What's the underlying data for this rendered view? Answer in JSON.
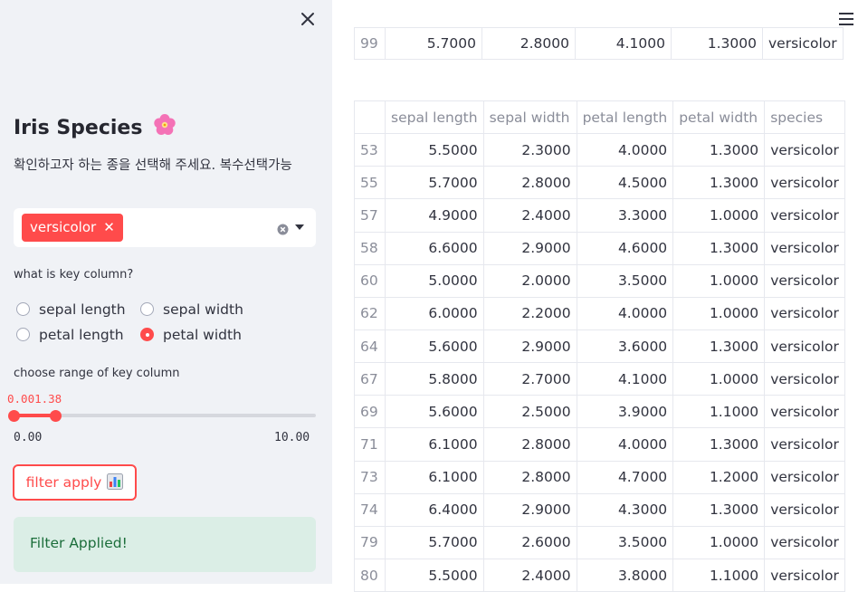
{
  "sidebar": {
    "title": "Iris Species",
    "description": "확인하고자 하는 종을 선택해 주세요. 복수선택가능",
    "multiselect": {
      "selected": [
        "versicolor"
      ]
    },
    "key_column": {
      "label": "what is key column?",
      "options": [
        "sepal length",
        "sepal width",
        "petal length",
        "petal width"
      ],
      "selected": "petal width"
    },
    "range": {
      "label": "choose range of key column",
      "value_text": "0.001.38",
      "low": 0.0,
      "high": 1.38,
      "min_label": "0.00",
      "max_label": "10.00",
      "min": 0,
      "max": 10
    },
    "filter_button": "filter apply",
    "alert": "Filter Applied!"
  },
  "top_table": {
    "row": {
      "index": "99",
      "sepal_length": "5.7000",
      "sepal_width": "2.8000",
      "petal_length": "4.1000",
      "petal_width": "1.3000",
      "species": "versicolor"
    }
  },
  "main_table": {
    "headers": [
      "",
      "sepal length",
      "sepal width",
      "petal length",
      "petal width",
      "species"
    ],
    "rows": [
      [
        "53",
        "5.5000",
        "2.3000",
        "4.0000",
        "1.3000",
        "versicolor"
      ],
      [
        "55",
        "5.7000",
        "2.8000",
        "4.5000",
        "1.3000",
        "versicolor"
      ],
      [
        "57",
        "4.9000",
        "2.4000",
        "3.3000",
        "1.0000",
        "versicolor"
      ],
      [
        "58",
        "6.6000",
        "2.9000",
        "4.6000",
        "1.3000",
        "versicolor"
      ],
      [
        "60",
        "5.0000",
        "2.0000",
        "3.5000",
        "1.0000",
        "versicolor"
      ],
      [
        "62",
        "6.0000",
        "2.2000",
        "4.0000",
        "1.0000",
        "versicolor"
      ],
      [
        "64",
        "5.6000",
        "2.9000",
        "3.6000",
        "1.3000",
        "versicolor"
      ],
      [
        "67",
        "5.8000",
        "2.7000",
        "4.1000",
        "1.0000",
        "versicolor"
      ],
      [
        "69",
        "5.6000",
        "2.5000",
        "3.9000",
        "1.1000",
        "versicolor"
      ],
      [
        "71",
        "6.1000",
        "2.8000",
        "4.0000",
        "1.3000",
        "versicolor"
      ],
      [
        "73",
        "6.1000",
        "2.8000",
        "4.7000",
        "1.2000",
        "versicolor"
      ],
      [
        "74",
        "6.4000",
        "2.9000",
        "4.3000",
        "1.3000",
        "versicolor"
      ],
      [
        "79",
        "5.7000",
        "2.6000",
        "3.5000",
        "1.0000",
        "versicolor"
      ],
      [
        "80",
        "5.5000",
        "2.4000",
        "3.8000",
        "1.1000",
        "versicolor"
      ]
    ]
  },
  "colors": {
    "accent": "#ff4b4b",
    "sidebar_bg": "#f0f2f6",
    "success_bg": "#dbeee6",
    "success_text": "#1c6e3b"
  },
  "icons": [
    "close-icon",
    "flower-icon",
    "clear-icon",
    "chevron-down-icon",
    "chart-icon",
    "hamburger-icon"
  ]
}
